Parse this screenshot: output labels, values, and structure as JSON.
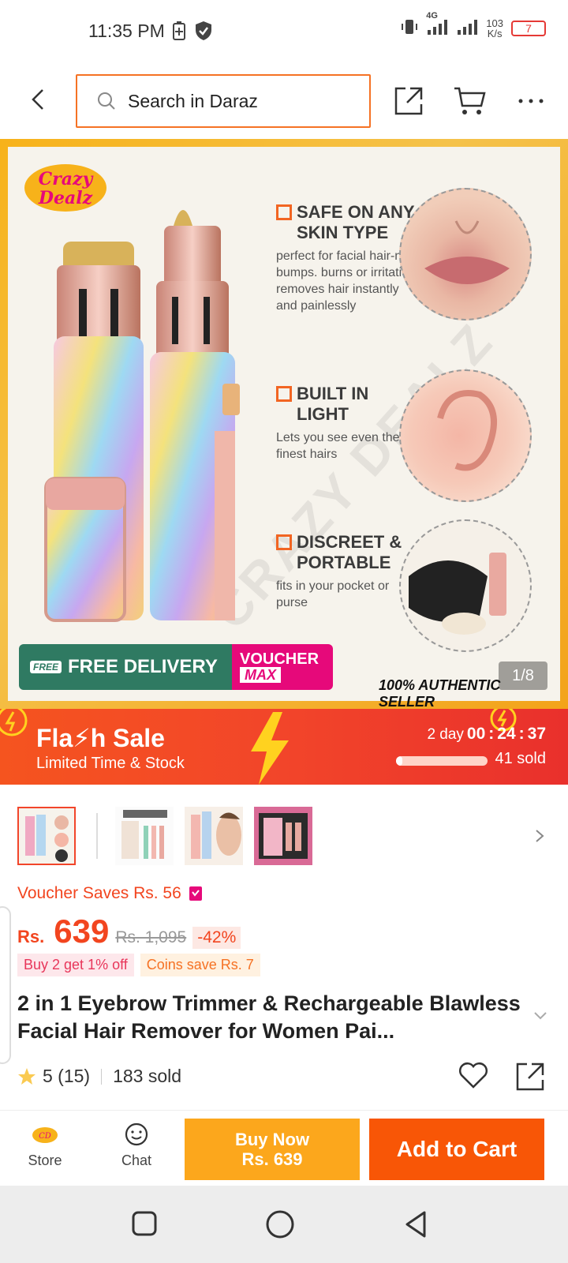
{
  "status_bar": {
    "time": "11:35 PM",
    "network": "4G",
    "speed_value": "103",
    "speed_unit": "K/s",
    "battery": "7"
  },
  "header": {
    "search_placeholder": "Search in Daraz"
  },
  "hero": {
    "logo_line1": "Crazy",
    "logo_line2": "Dealz",
    "features": [
      {
        "title": "SAFE ON ANY SKIN TYPE",
        "desc": "perfect for facial hair-no bumps. burns or irritation removes hair instantly and painlessly"
      },
      {
        "title": "BUILT IN LIGHT",
        "desc": "Lets you see even the finest hairs"
      },
      {
        "title": "DISCREET & PORTABLE",
        "desc": "fits in your pocket or purse"
      }
    ],
    "watermark": "CRAZY DEALZ",
    "promo_free_tag": "FREE",
    "promo_free": "FREE DELIVERY",
    "promo_voucher": "VOUCHER",
    "promo_max": "MAX",
    "authentic": "100% AUTHENTIC SELLER",
    "pager": "1/8"
  },
  "flash_sale": {
    "title": "Fla⚡h Sale",
    "subtitle": "Limited Time & Stock",
    "days": "2 day",
    "hours": "00",
    "minutes": "24",
    "seconds": "37",
    "sold": "41 sold",
    "progress": 0.07
  },
  "thumbnails": [
    "thumb-1",
    "thumb-2",
    "thumb-3",
    "thumb-4"
  ],
  "product": {
    "voucher_saves": "Voucher Saves Rs. 56",
    "currency": "Rs.",
    "price": "639",
    "old_price": "Rs. 1,095",
    "discount": "-42%",
    "tag_buy2": "Buy 2 get 1% off",
    "tag_coins": "Coins save Rs. 7",
    "title": "2 in 1 Eyebrow Trimmer & Rechargeable Blawless Facial Hair Remover for Women Pai...",
    "rating": "5 (15)",
    "sold": "183 sold"
  },
  "action_bar": {
    "store": "Store",
    "chat": "Chat",
    "buy_now": "Buy Now",
    "buy_now_price": "Rs. 639",
    "add_to_cart": "Add to Cart"
  },
  "colors": {
    "accent": "#f57224",
    "price": "#f2451f",
    "buy_now": "#fca71c",
    "add_to_cart": "#f85606"
  }
}
